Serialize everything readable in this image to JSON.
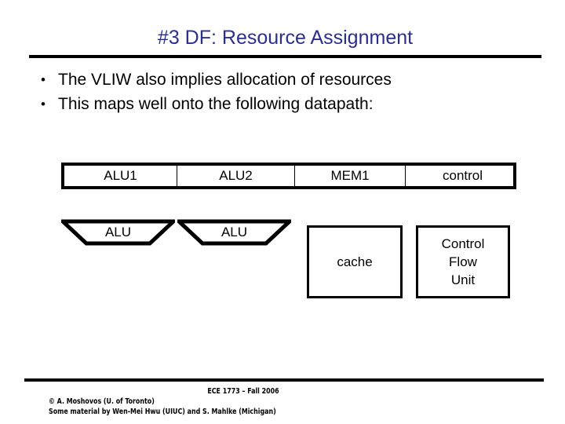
{
  "slide": {
    "title": "#3 DF: Resource Assignment",
    "title_color": "#2b2f8f",
    "bullet_marker": "•",
    "bullets": [
      "The VLIW also implies allocation of resources",
      "This maps well onto the following datapath:"
    ]
  },
  "diagram": {
    "resource_row": {
      "cells": [
        {
          "label": "ALU1"
        },
        {
          "label": "ALU2"
        },
        {
          "label": "MEM1"
        },
        {
          "label": "control"
        }
      ]
    },
    "alu_units": [
      {
        "label": "ALU"
      },
      {
        "label": "ALU"
      }
    ],
    "boxes": [
      {
        "label": "cache"
      },
      {
        "label": "Control\nFlow\nUnit",
        "line1": "Control",
        "line2": "Flow",
        "line3": "Unit"
      }
    ]
  },
  "footer": {
    "course": "ECE 1773 – Fall 2006",
    "copyright": "© A. Moshovos (U. of Toronto)",
    "credits": "Some material by Wen-Mei Hwu (UIUC) and S. Mahlke (Michigan)"
  }
}
